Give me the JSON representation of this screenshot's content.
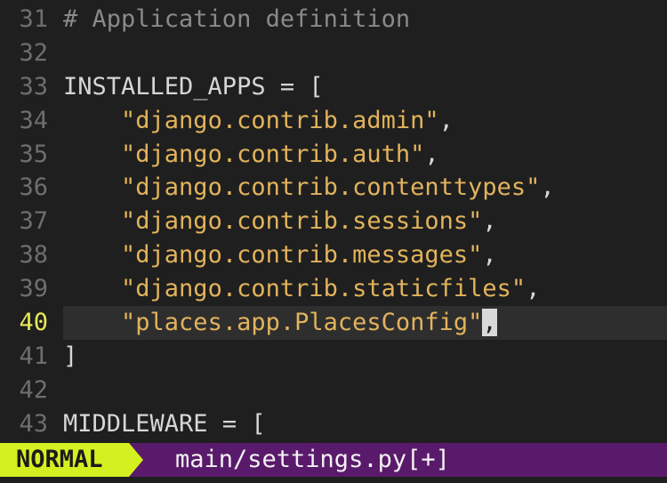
{
  "buffer": {
    "lines": [
      {
        "num": "31",
        "text": "# Application definition"
      },
      {
        "num": "32",
        "text": ""
      },
      {
        "num": "33",
        "ident": "INSTALLED_APPS",
        "rest": " = ["
      },
      {
        "num": "34",
        "indent": "    ",
        "str": "\"django.contrib.admin\"",
        "tail": ","
      },
      {
        "num": "35",
        "indent": "    ",
        "str": "\"django.contrib.auth\"",
        "tail": ","
      },
      {
        "num": "36",
        "indent": "    ",
        "str": "\"django.contrib.contenttypes\"",
        "tail": ","
      },
      {
        "num": "37",
        "indent": "    ",
        "str": "\"django.contrib.sessions\"",
        "tail": ","
      },
      {
        "num": "38",
        "indent": "    ",
        "str": "\"django.contrib.messages\"",
        "tail": ","
      },
      {
        "num": "39",
        "indent": "    ",
        "str": "\"django.contrib.staticfiles\"",
        "tail": ","
      },
      {
        "num": "40",
        "indent": "    ",
        "str": "\"places.app.PlacesConfig\"",
        "tail": ","
      },
      {
        "num": "41",
        "text": "]"
      },
      {
        "num": "42",
        "text": ""
      },
      {
        "num": "43",
        "ident": "MIDDLEWARE",
        "rest": " = ["
      }
    ]
  },
  "statusline": {
    "mode": "NORMAL",
    "filename": "main/settings.py[+]"
  },
  "colors": {
    "background": "#1f1f1f",
    "string": "#e2b35c",
    "current_line_number": "#e8e85a",
    "mode_background": "#d4f020",
    "statusline_background": "#5a1a6b"
  }
}
